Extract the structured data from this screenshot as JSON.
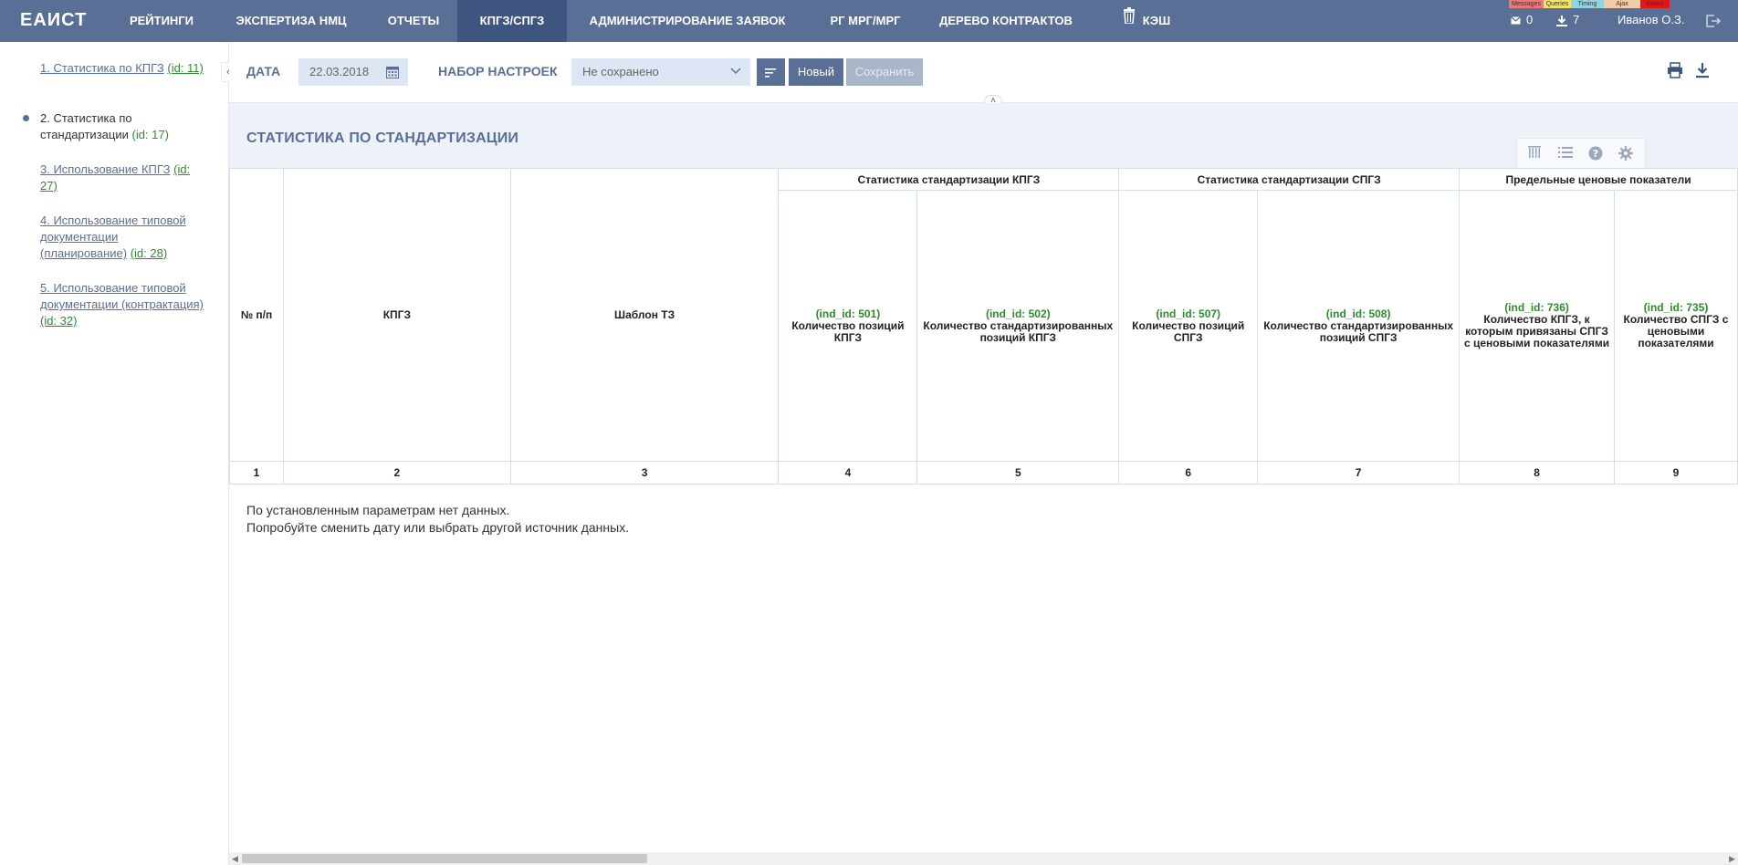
{
  "nav": {
    "logo": "ЕАИСТ",
    "items": [
      {
        "label": "РЕЙТИНГИ",
        "active": false
      },
      {
        "label": "ЭКСПЕРТИЗА НМЦ",
        "active": false
      },
      {
        "label": "ОТЧЕТЫ",
        "active": false
      },
      {
        "label": "КПГЗ/СПГЗ",
        "active": true
      },
      {
        "label": "АДМИНИСТРИРОВАНИЕ ЗАЯВОК",
        "active": false
      },
      {
        "label": "РГ МРГ/МРГ",
        "active": false
      },
      {
        "label": "ДЕРЕВО КОНТРАКТОВ",
        "active": false
      },
      {
        "label": "КЭШ",
        "active": false,
        "icon": "trash-icon"
      }
    ],
    "debug_tabs": [
      {
        "label": "Messages",
        "color": "#e87a7a"
      },
      {
        "label": "Queries",
        "color": "#f2e36a"
      },
      {
        "label": "Timing",
        "color": "#8fd6e0"
      },
      {
        "label": "Ajax",
        "color": "#f5ccaa"
      },
      {
        "label": "Errors",
        "color": "#e01515"
      }
    ],
    "mail_count": "0",
    "download_count": "7",
    "user_name": "Иванов О.З."
  },
  "sidebar": {
    "items": [
      {
        "label": "1. Статистика по КПГЗ",
        "id": "(id: 11)",
        "current": false
      },
      {
        "label": "2. Статистика по стандартизации",
        "id": "(id: 17)",
        "current": true
      },
      {
        "label": "3. Использование КПГЗ",
        "id": "(id: 27)",
        "current": false
      },
      {
        "label": "4. Использование типовой документации (планирование)",
        "id": "(id: 28)",
        "current": false
      },
      {
        "label": "5. Использование типовой документации (контрактация)",
        "id": "(id: 32)",
        "current": false
      }
    ]
  },
  "filters": {
    "date_label": "ДАТА",
    "date_value": "22.03.2018",
    "settings_label": "НАБОР НАСТРОЕК",
    "settings_value": "Не сохранено",
    "new_button": "Новый",
    "save_button": "Сохранить"
  },
  "report": {
    "title": "СТАТИСТИКА ПО СТАНДАРТИЗАЦИИ",
    "groups": {
      "kpgz": "Статистика стандартизации КПГЗ",
      "spgz": "Статистика стандартизации СПГЗ",
      "price": "Предельные ценовые показатели"
    },
    "columns": {
      "num": "№ п/п",
      "kpgz": "КПГЗ",
      "template": "Шаблон ТЗ",
      "c4_id": "(ind_id: 501)",
      "c4_label": "Количество позиций КПГЗ",
      "c5_id": "(ind_id: 502)",
      "c5_label": "Количество стандартизированных позиций КПГЗ",
      "c6_id": "(ind_id: 507)",
      "c6_label": "Количество позиций СПГЗ",
      "c7_id": "(ind_id: 508)",
      "c7_label": "Количество стандартизированных позиций СПГЗ",
      "c8_id": "(ind_id: 736)",
      "c8_label": "Количество КПГЗ, к которым привязаны СПГЗ с ценовыми показателями",
      "c9_id": "(ind_id: 735)",
      "c9_label": "Количество СПГЗ с ценовыми показателями"
    },
    "col_numbers": [
      "1",
      "2",
      "3",
      "4",
      "5",
      "6",
      "7",
      "8",
      "9"
    ],
    "empty_line1": "По установленным параметрам нет данных.",
    "empty_line2": "Попробуйте сменить дату или выбрать другой источник данных."
  }
}
